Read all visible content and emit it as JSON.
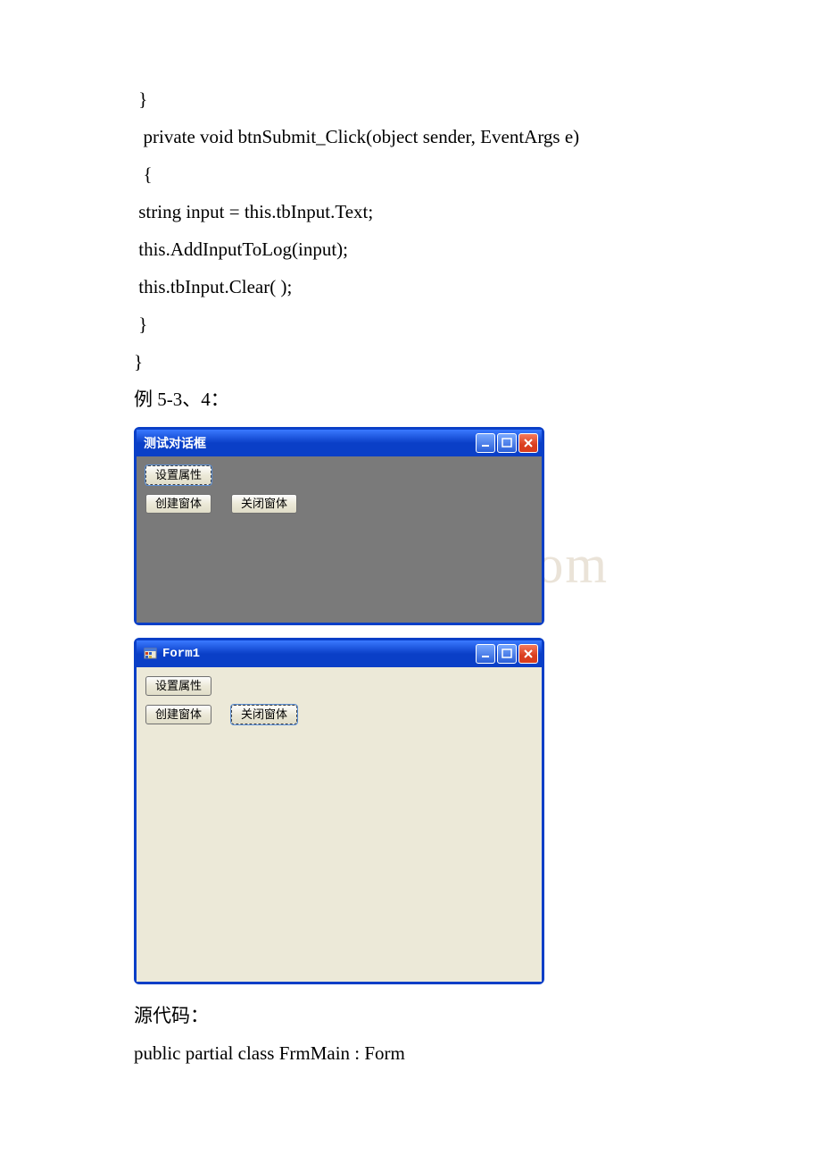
{
  "code": {
    "l1": " }",
    "l2": "  private void btnSubmit_Click(object sender, EventArgs e)",
    "l3": "  {",
    "l4": " string input = this.tbInput.Text;",
    "l5": " this.AddInputToLog(input);",
    "l6": " this.tbInput.Clear( );",
    "l7": " }",
    "l8": "}"
  },
  "text": {
    "example_label": "例 5-3、4：",
    "source_label": "源代码：",
    "class_decl": "public partial class FrmMain : Form"
  },
  "watermark": "www.bdocx.com",
  "window1": {
    "title": "测试对话框",
    "btn1": "设置属性",
    "btn2": "创建窗体",
    "btn3": "关闭窗体"
  },
  "window2": {
    "title": "Form1",
    "btn1": "设置属性",
    "btn2": "创建窗体",
    "btn3": "关闭窗体"
  }
}
